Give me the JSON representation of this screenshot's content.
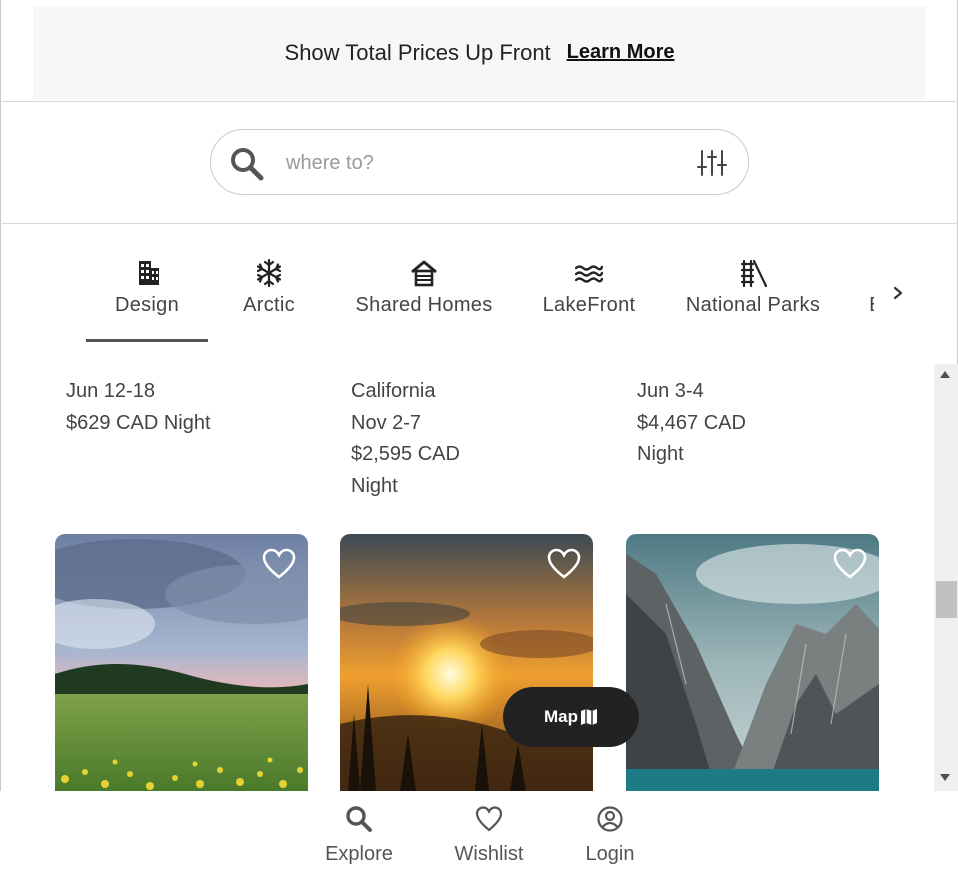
{
  "banner": {
    "message": "Show Total Prices Up Front",
    "link": "Learn More"
  },
  "search": {
    "placeholder": "where to?",
    "value": ""
  },
  "categories": [
    {
      "label": "Design",
      "icon": "building-icon",
      "active": true
    },
    {
      "label": "Arctic",
      "icon": "snowflake-icon"
    },
    {
      "label": "Shared Homes",
      "icon": "house-icon"
    },
    {
      "label": "LakeFront",
      "icon": "waves-icon"
    },
    {
      "label": "National Parks",
      "icon": "trail-icon"
    },
    {
      "label": "B",
      "icon": ""
    }
  ],
  "listings_top": [
    {
      "dates": "Jun 12-18",
      "price": "$629 CAD Night"
    },
    {
      "location": "California",
      "dates": "Nov 2-7",
      "price": "$2,595 CAD",
      "unit": "Night"
    },
    {
      "dates": "Jun 3-4",
      "price": "$4,467 CAD",
      "unit": "Night"
    }
  ],
  "cards": [
    {
      "scene": "meadow-storm"
    },
    {
      "scene": "sunset-forest"
    },
    {
      "scene": "mountain-lake"
    }
  ],
  "map_button": {
    "label": "Map"
  },
  "bottom_nav": [
    {
      "label": "Explore",
      "icon": "search-icon"
    },
    {
      "label": "Wishlist",
      "icon": "heart-icon"
    },
    {
      "label": "Login",
      "icon": "user-circle-icon"
    }
  ],
  "colors": {
    "accent": "#222222",
    "muted": "#444444",
    "banner_bg": "#f7f7f7"
  }
}
